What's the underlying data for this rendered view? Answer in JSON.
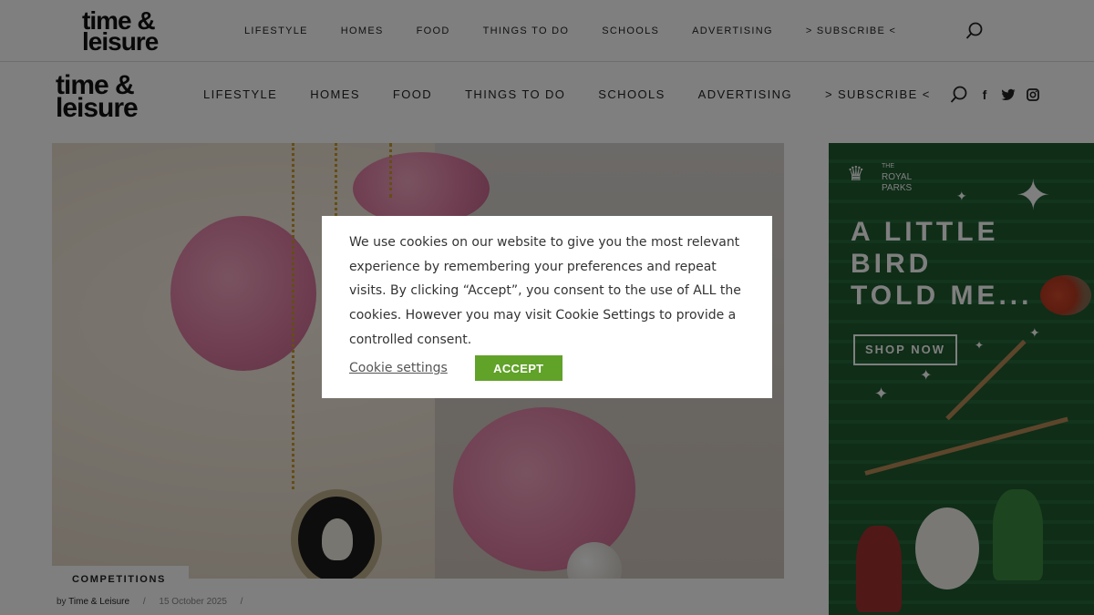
{
  "brand": {
    "logo_line1": "time &",
    "logo_line2": "leisure"
  },
  "nav": {
    "items": [
      {
        "label": "LIFESTYLE"
      },
      {
        "label": "HOMES"
      },
      {
        "label": "FOOD"
      },
      {
        "label": "THINGS TO DO"
      },
      {
        "label": "SCHOOLS"
      },
      {
        "label": "ADVERTISING"
      },
      {
        "label": "> SUBSCRIBE <"
      }
    ]
  },
  "social_icons": [
    "search-icon",
    "facebook-icon",
    "twitter-icon",
    "instagram-icon"
  ],
  "article": {
    "category": "COMPETITIONS",
    "byline_prefix": "by",
    "author": "Time & Leisure",
    "separator": "/",
    "date": "15 October 2025"
  },
  "ad": {
    "brand_line1": "THE",
    "brand_line2": "ROYAL",
    "brand_line3": "PARKS",
    "headline_line1": "A LITTLE",
    "headline_line2": "BIRD",
    "headline_line3": "TOLD ME...",
    "cta": "SHOP NOW"
  },
  "cookie": {
    "message": "We use cookies on our website to give you the most relevant experience by remembering your preferences and repeat visits. By clicking “Accept”, you consent to the use of ALL the cookies. However you may visit Cookie Settings to provide a controlled consent.",
    "settings_label": "Cookie settings",
    "accept_label": "ACCEPT"
  },
  "colors": {
    "accept_green": "#61a229",
    "overlay": "rgba(0,0,0,0.5)",
    "ad_green": "#1f5a2f"
  }
}
